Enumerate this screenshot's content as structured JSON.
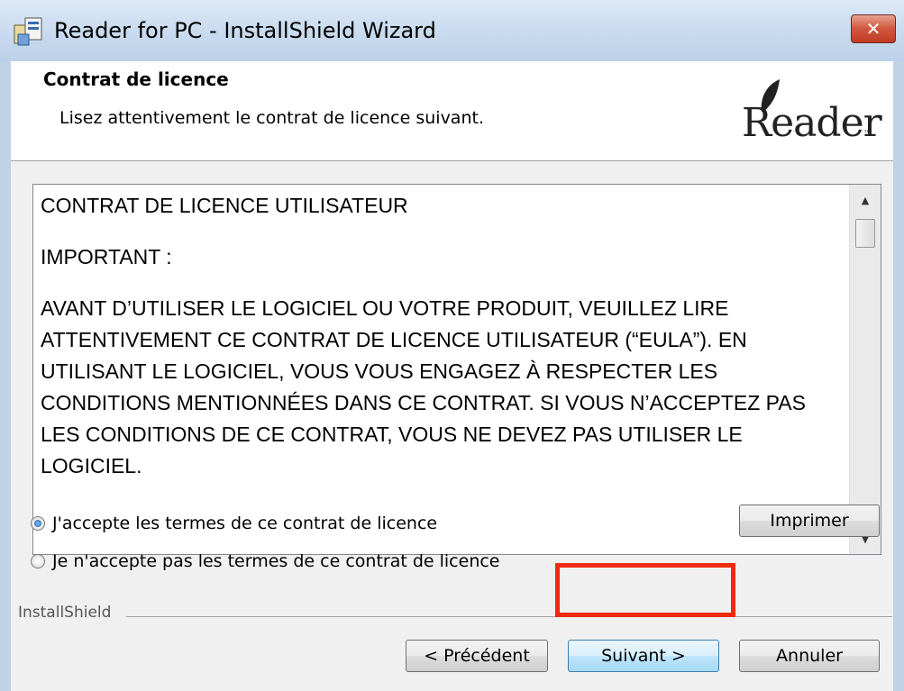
{
  "window": {
    "title": "Reader for PC - InstallShield Wizard",
    "close_glyph": "✕"
  },
  "header": {
    "title": "Contrat de licence",
    "subtitle": "Lisez attentivement le contrat de licence suivant.",
    "logo_text": "Reader",
    "logo_tm": "™"
  },
  "license": {
    "paragraphs": [
      "CONTRAT DE LICENCE UTILISATEUR",
      "IMPORTANT :",
      "AVANT D’UTILISER LE LOGICIEL OU VOTRE PRODUIT, VEUILLEZ LIRE ATTENTIVEMENT CE CONTRAT DE LICENCE UTILISATEUR (“EULA”). EN UTILISANT LE LOGICIEL, VOUS VOUS ENGAGEZ À RESPECTER LES CONDITIONS MENTIONNÉES DANS CE CONTRAT. SI VOUS N’ACCEPTEZ PAS LES CONDITIONS DE CE CONTRAT, VOUS NE DEVEZ PAS UTILISER LE LOGICIEL."
    ]
  },
  "options": {
    "accept_label": "J'accepte les termes de ce contrat de licence",
    "decline_label": "Je n'accepte pas les termes de ce contrat de licence",
    "selected": "accept"
  },
  "buttons": {
    "print_label": "Imprimer",
    "back_label": "< Précédent",
    "next_label": "Suivant >",
    "cancel_label": "Annuler"
  },
  "footer": {
    "group_label": "InstallShield"
  },
  "colors": {
    "highlight": "#ee2a0e",
    "titlebar": "#c6d9ee",
    "close": "#c23b22"
  }
}
